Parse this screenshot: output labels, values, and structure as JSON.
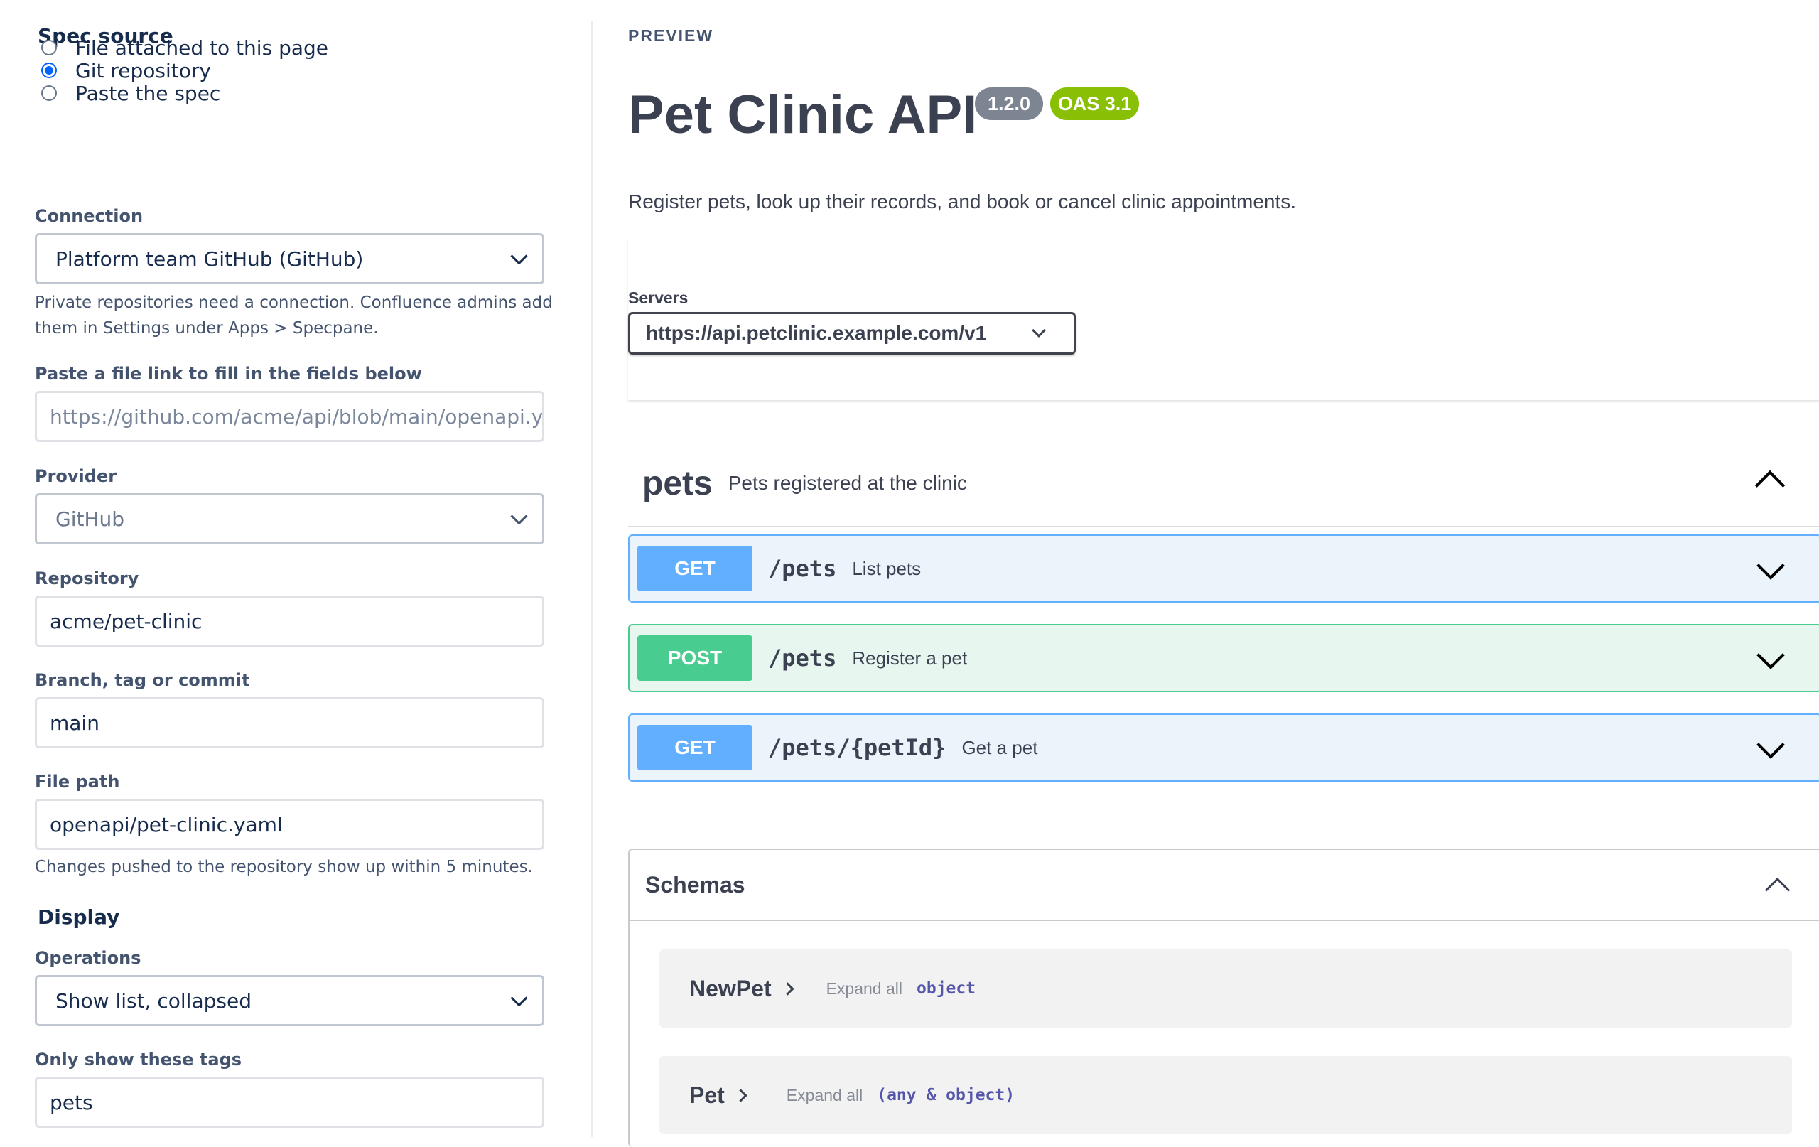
{
  "spec_source": {
    "heading": "Spec source",
    "options": [
      {
        "label": "File attached to this page",
        "selected": false
      },
      {
        "label": "Git repository",
        "selected": true
      },
      {
        "label": "Paste the spec",
        "selected": false
      }
    ]
  },
  "connection": {
    "label": "Connection",
    "value": "Platform team GitHub (GitHub)",
    "help": "Private repositories need a connection. Confluence admins add them in Settings under Apps > Specpane."
  },
  "file_link": {
    "label": "Paste a file link to fill in the fields below",
    "placeholder": "https://github.com/acme/api/blob/main/openapi.yam"
  },
  "provider": {
    "label": "Provider",
    "value": "GitHub"
  },
  "repository": {
    "label": "Repository",
    "value": "acme/pet-clinic"
  },
  "branch": {
    "label": "Branch, tag or commit",
    "value": "main"
  },
  "file_path": {
    "label": "File path",
    "value": "openapi/pet-clinic.yaml",
    "help": "Changes pushed to the repository show up within 5 minutes."
  },
  "display": {
    "heading": "Display",
    "operations_label": "Operations",
    "operations_value": "Show list, collapsed",
    "tags_label": "Only show these tags",
    "tags_value": "pets"
  },
  "preview": {
    "label": "PREVIEW",
    "title": "Pet Clinic API",
    "version_badge": "1.2.0",
    "oas_badge": "OAS 3.1",
    "description": "Register pets, look up their records, and book or cancel clinic appointments.",
    "servers_label": "Servers",
    "server_value": "https://api.petclinic.example.com/v1",
    "tag": {
      "name": "pets",
      "description": "Pets registered at the clinic"
    },
    "operations": [
      {
        "method": "GET",
        "path": "/pets",
        "summary": "List pets"
      },
      {
        "method": "POST",
        "path": "/pets",
        "summary": "Register a pet"
      },
      {
        "method": "GET",
        "path": "/pets/{petId}",
        "summary": "Get a pet"
      }
    ],
    "schemas_title": "Schemas",
    "schemas": [
      {
        "name": "NewPet",
        "expand": "Expand all",
        "type": "object"
      },
      {
        "name": "Pet",
        "expand": "Expand all",
        "type": "(any & object)"
      }
    ]
  },
  "colors": {
    "get": "#61affe",
    "post": "#49cc90",
    "badge_version": "#7d8492",
    "badge_oas": "#89bf04",
    "radio_selected": "#0065ff"
  }
}
